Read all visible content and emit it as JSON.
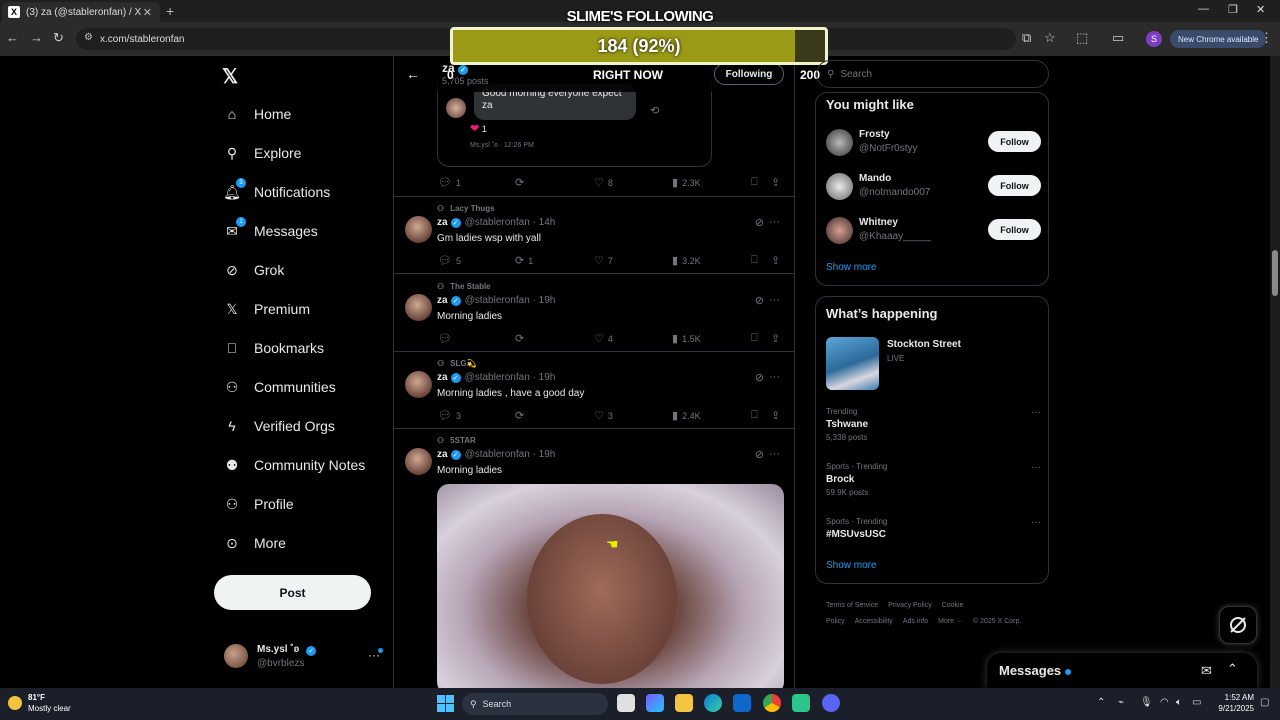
{
  "browser": {
    "tab_title": "(3) za (@stableronfan) / X",
    "tab_close": "✕",
    "new_tab": "+",
    "url": "x.com/stableronfan",
    "profile_initial": "S",
    "new_chrome": "New Chrome available"
  },
  "overlay": {
    "title": "SLIME'S FOLLOWING",
    "progress_text": "184 (92%)",
    "progress_value": 0.92,
    "left_value": "0",
    "subtitle": "RIGHT NOW",
    "right_value": "200",
    "fill_color": "#9a9a16"
  },
  "nav": {
    "items": [
      {
        "label": "Home",
        "icon": "home-icon"
      },
      {
        "label": "Explore",
        "icon": "search-icon"
      },
      {
        "label": "Notifications",
        "icon": "bell-icon",
        "badge": "3"
      },
      {
        "label": "Messages",
        "icon": "mail-icon",
        "badge": "1"
      },
      {
        "label": "Grok",
        "icon": "grok-icon"
      },
      {
        "label": "Premium",
        "icon": "x-icon"
      },
      {
        "label": "Bookmarks",
        "icon": "bookmark-icon"
      },
      {
        "label": "Communities",
        "icon": "communities-icon"
      },
      {
        "label": "Verified Orgs",
        "icon": "lightning-icon"
      },
      {
        "label": "Community Notes",
        "icon": "community-notes-icon"
      },
      {
        "label": "Profile",
        "icon": "person-icon"
      },
      {
        "label": "More",
        "icon": "more-circle-icon"
      }
    ],
    "post_label": "Post",
    "account_name": "Ms.ysl ˚ʚ",
    "account_handle": "@bvrblezs"
  },
  "profile_header": {
    "name": "za",
    "posts": "5,705 posts",
    "following_label": "Following"
  },
  "quoted": {
    "text": "Good morning everyone expect za",
    "reaction_count": "1",
    "meta": "Ms.ysl ˚ʚ · 12:26 PM"
  },
  "first_actions": {
    "replies": "1",
    "reposts": "",
    "likes": "8",
    "views": "2.3K"
  },
  "tweets": [
    {
      "community": "Lacy Thugs",
      "name": "za",
      "handle": "@stableronfan",
      "time": "· 14h",
      "text": "Gm ladies wsp with yall",
      "replies": "5",
      "reposts": "1",
      "likes": "7",
      "views": "3.2K"
    },
    {
      "community": "The Stable",
      "name": "za",
      "handle": "@stableronfan",
      "time": "· 19h",
      "text": "Morning ladies",
      "replies": "",
      "reposts": "",
      "likes": "4",
      "views": "1.5K"
    },
    {
      "community": "SLG💫",
      "name": "za",
      "handle": "@stableronfan",
      "time": "· 19h",
      "text": "Morning ladies , have a good day",
      "replies": "3",
      "reposts": "",
      "likes": "3",
      "views": "2.4K"
    },
    {
      "community": "5STAR",
      "name": "za",
      "handle": "@stableronfan",
      "time": "· 19h",
      "text": "Morning ladies"
    }
  ],
  "right": {
    "search_placeholder": "Search",
    "might_like_title": "You might like",
    "suggestions": [
      {
        "name": "Frosty",
        "handle": "@NotFr0styy",
        "follow": "Follow"
      },
      {
        "name": "Mando",
        "handle": "@notmando007",
        "follow": "Follow"
      },
      {
        "name": "Whitney",
        "handle": "@Khaaay_____",
        "follow": "Follow"
      }
    ],
    "show_more": "Show more",
    "happening_title": "What’s happening",
    "live_event": {
      "name": "Stockton Street",
      "status": "LIVE"
    },
    "trends": [
      {
        "context": "Trending",
        "name": "Tshwane",
        "posts": "5,338 posts"
      },
      {
        "context": "Sports · Trending",
        "name": "Brock",
        "posts": "59.9K posts"
      },
      {
        "context": "Sports · Trending",
        "name": "#MSUvsUSC",
        "posts": ""
      }
    ],
    "show_more_2": "Show more",
    "footer": [
      "Terms of Service",
      "Privacy Policy",
      "Cookie Policy",
      "Accessibility",
      "Ads info",
      "More ···",
      "© 2025 X Corp."
    ],
    "messages_title": "Messages"
  },
  "taskbar": {
    "temp": "81°F",
    "weather": "Mostly clear",
    "search": "Search",
    "time": "1:52 AM",
    "date": "9/21/2025"
  }
}
